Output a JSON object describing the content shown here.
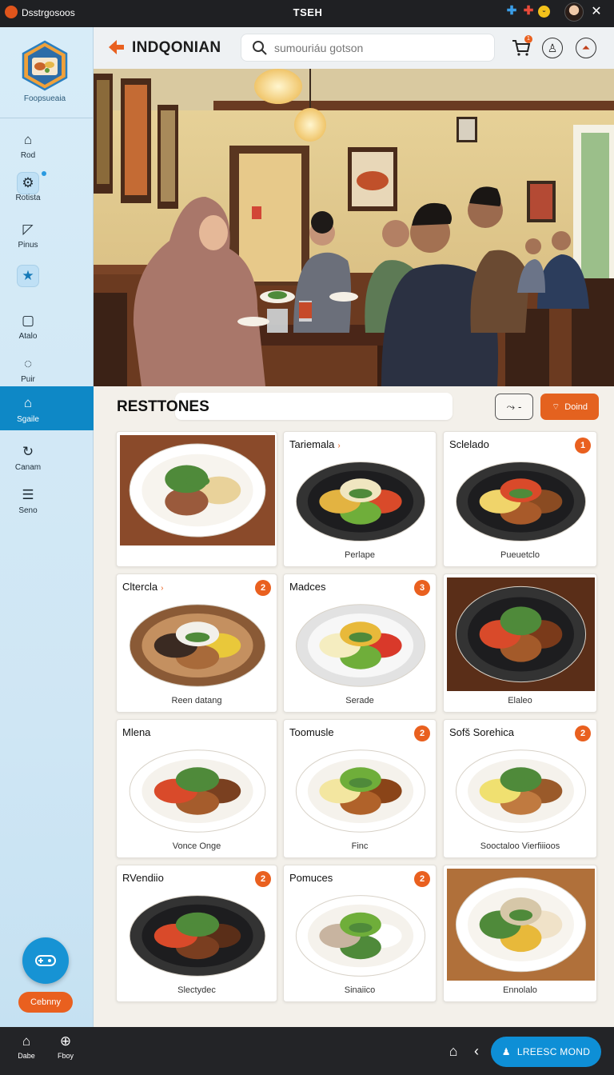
{
  "titlebar": {
    "app_name": "Dsstrgosoos",
    "window_title": "TSEH",
    "icons": [
      "plus-icon",
      "add-icon",
      "smiley-icon"
    ]
  },
  "sidebar": {
    "logo_caption": "Foopsueaia",
    "items": [
      {
        "label": "Rod",
        "icon": "home-icon"
      },
      {
        "label": "Rotista",
        "icon": "gear-icon"
      },
      {
        "label": "Pinus",
        "icon": "bookmark-icon"
      },
      {
        "label": "",
        "icon": "star-card-icon"
      },
      {
        "label": "Atalo",
        "icon": "square-icon"
      },
      {
        "label": "Puir",
        "icon": "chat-icon"
      },
      {
        "label": "Sgaile",
        "icon": "house-icon"
      },
      {
        "label": "Canam",
        "icon": "refresh-icon"
      },
      {
        "label": "Seno",
        "icon": "menu-icon"
      }
    ],
    "active_index": 6,
    "pill_label": "Cebnny"
  },
  "header": {
    "brand": "INDQONIAN",
    "search_placeholder": "sumouriáu gotson",
    "cart_count": "1"
  },
  "section": {
    "title": "RESTTONES",
    "filter_label": "-",
    "detail_label": "Doind"
  },
  "cards": [
    {
      "title": "",
      "caption": "",
      "badge": "",
      "chevron": false
    },
    {
      "title": "Tariemala",
      "caption": "Perlape",
      "badge": "",
      "chevron": true
    },
    {
      "title": "Sclelado",
      "caption": "Pueuetclo",
      "badge": "1",
      "chevron": false
    },
    {
      "title": "Cltercla",
      "caption": "Reen datang",
      "badge": "2",
      "chevron": true
    },
    {
      "title": "Madces",
      "caption": "Serade",
      "badge": "3",
      "chevron": false
    },
    {
      "title": "",
      "caption": "Elaleo",
      "badge": "",
      "chevron": false
    },
    {
      "title": "Mlena",
      "caption": "Vonce Onge",
      "badge": "",
      "chevron": false
    },
    {
      "title": "Toomusle",
      "caption": "Finc",
      "badge": "2",
      "chevron": false
    },
    {
      "title": "Sofš Sorehica",
      "caption": "Sooctaloo Vierfiiioos",
      "badge": "2",
      "chevron": false
    },
    {
      "title": "RVendiio",
      "caption": "Slectydec",
      "badge": "2",
      "chevron": false
    },
    {
      "title": "Pomuces",
      "caption": "Sinaiico",
      "badge": "2",
      "chevron": false
    },
    {
      "title": "",
      "caption": "Ennolalo",
      "badge": "",
      "chevron": false
    }
  ],
  "bottombar": {
    "items": [
      {
        "label": "Dabe",
        "icon": "home-icon"
      },
      {
        "label": "Fboy",
        "icon": "globe-icon"
      }
    ],
    "cta_label": "LREESC MOND"
  },
  "colors": {
    "accent": "#e9601f",
    "primary": "#0e88c6",
    "sidebar_bg": "#d7ecf8",
    "bar_bg": "#232427"
  }
}
